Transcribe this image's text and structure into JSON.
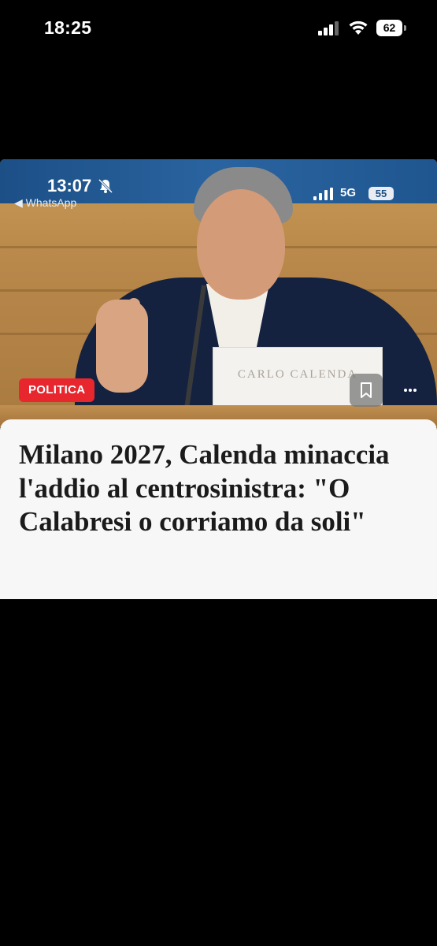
{
  "status_bar": {
    "time": "18:25",
    "battery_level": "62",
    "icons": [
      "signal-icon",
      "wifi-icon",
      "battery-icon"
    ]
  },
  "embedded_screenshot": {
    "status_bar": {
      "time": "13:07",
      "back_label": "◀ WhatsApp",
      "network": "5G",
      "battery_level": "55",
      "icons": [
        "bell-off-icon",
        "signal-icon",
        "battery-icon"
      ]
    },
    "photo": {
      "nameplate_text": "CARLO CALENDA"
    },
    "category": "POLITICA",
    "category_color": "#e8262d",
    "actions": {
      "bookmark_icon": "bookmark-icon",
      "more_icon": "more-icon"
    },
    "article": {
      "headline": "Milano 2027, Calenda minaccia l'addio al centrosinistra: \"O Calabresi o corriamo da soli\""
    }
  }
}
